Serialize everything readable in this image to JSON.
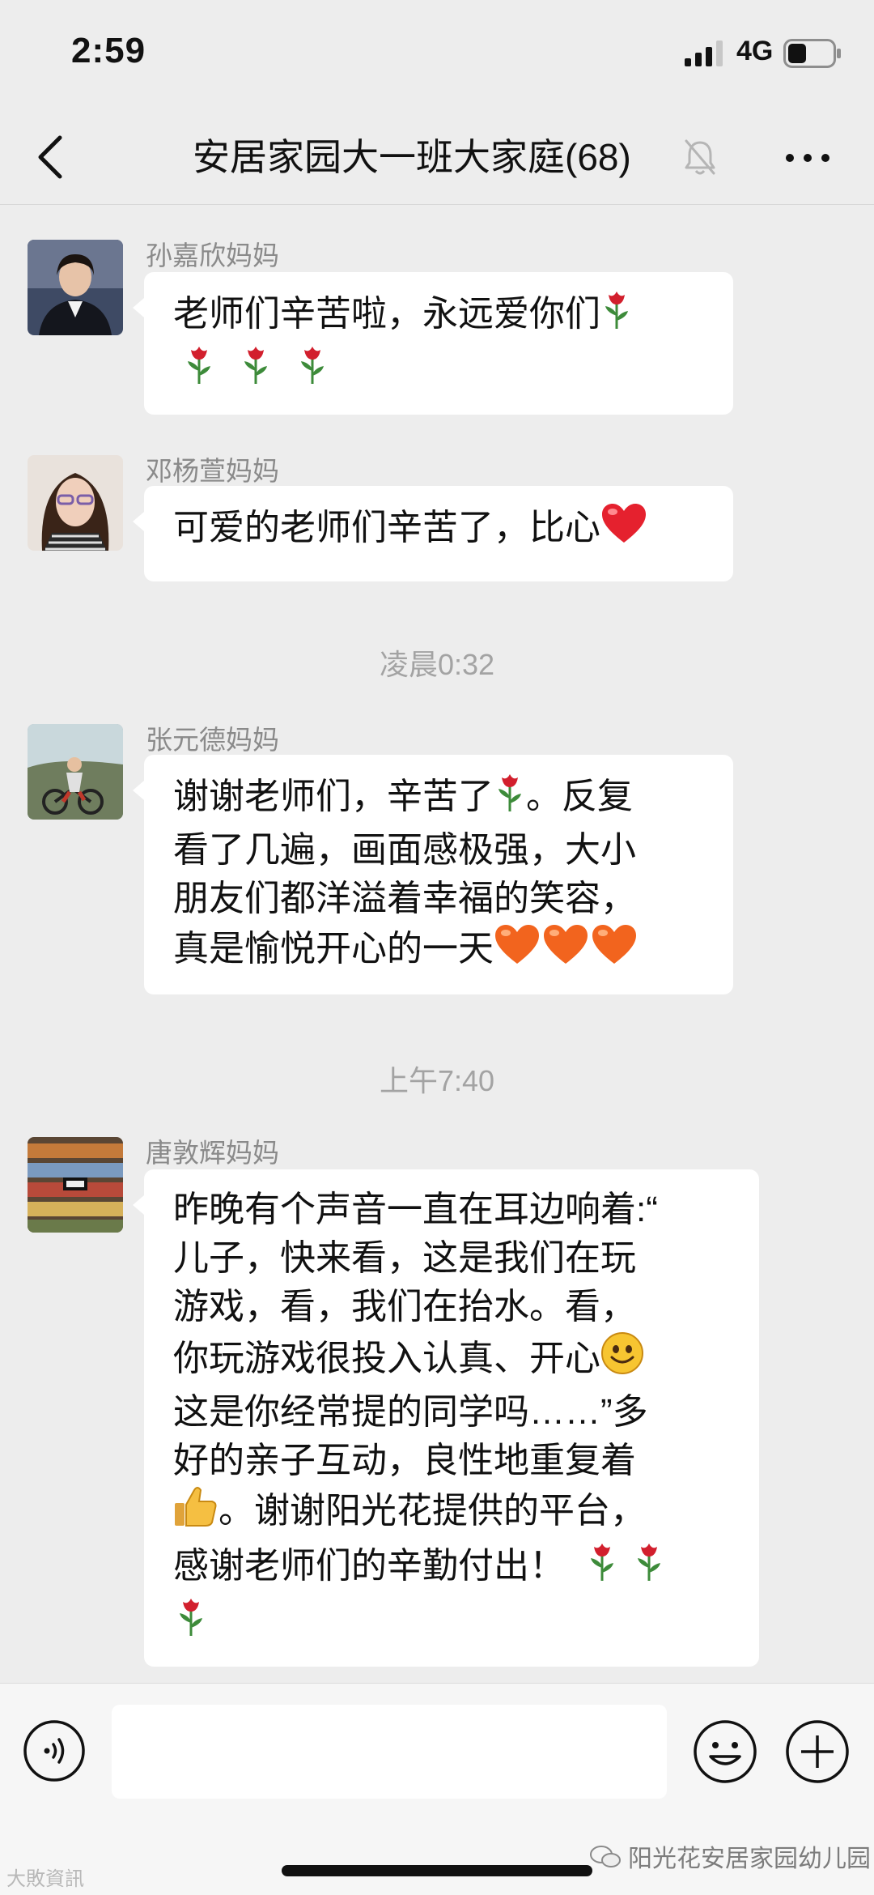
{
  "status_bar": {
    "time": "2:59",
    "network": "4G"
  },
  "header": {
    "title": "安居家园大一班大家庭(68)"
  },
  "messages": [
    {
      "sender": "孙嘉欣妈妈",
      "lines": [
        "老师们辛苦啦，永远爱你们"
      ]
    },
    {
      "sender": "邓杨萱妈妈",
      "lines": [
        "可爱的老师们辛苦了，比心"
      ]
    },
    {
      "sender": "张元德妈妈",
      "lines": [
        "谢谢老师们，辛苦了",
        "。反复",
        "看了几遍，画面感极强，大小",
        "朋友们都洋溢着幸福的笑容，",
        "真是愉悦开心的一天"
      ]
    },
    {
      "sender": "唐敦辉妈妈",
      "lines": [
        "昨晚有个声音一直在耳边响着:“",
        "儿子，快来看，这是我们在玩",
        "游戏，看，我们在抬水。看，",
        "你玩游戏很投入认真、开心",
        "这是你经常提的同学吗……”多",
        "好的亲子互动，良性地重复着",
        "。谢谢阳光花提供的平台，",
        "感谢老师们的辛勤付出！"
      ]
    }
  ],
  "timestamps": [
    "凌晨0:32",
    "上午7:40"
  ],
  "watermarks": {
    "right": "阳光花安居家园幼儿园",
    "left": "大敗資訊"
  },
  "colors": {
    "background": "#ededed",
    "bubble": "#ffffff",
    "meta_text": "#8a8a8a"
  }
}
